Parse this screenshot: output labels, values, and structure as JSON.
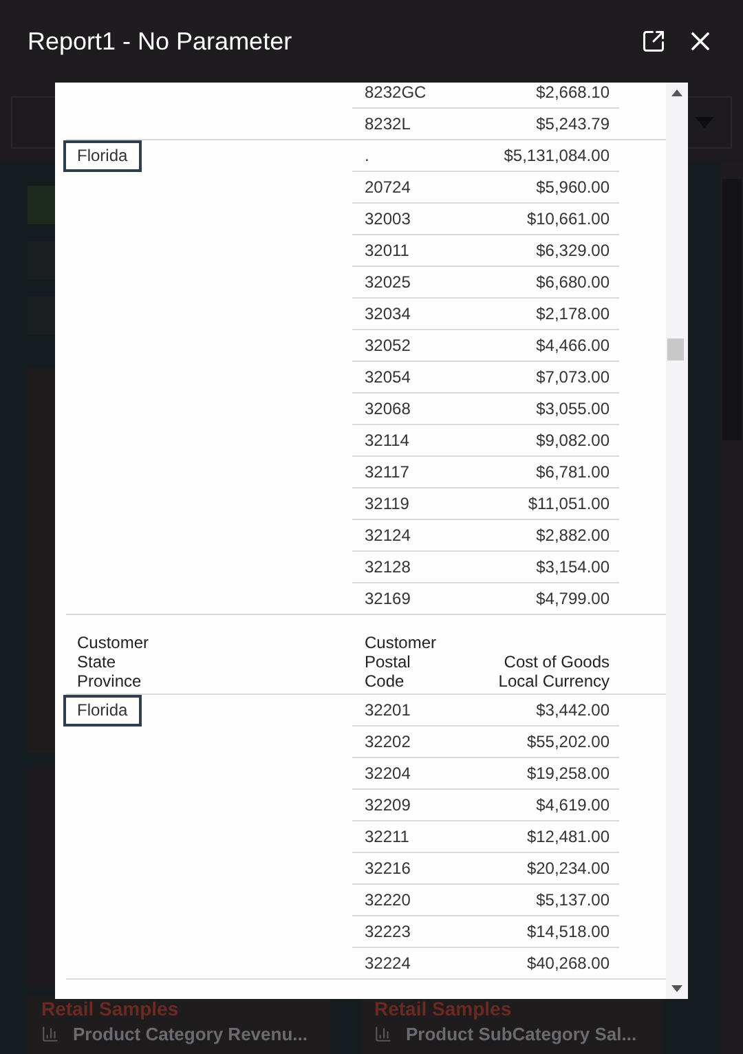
{
  "background": {
    "cards": [
      {
        "source": "Retail Samples",
        "title": "Product Category Revenu..."
      },
      {
        "source": "Retail Samples",
        "title": "Product SubCategory Sal..."
      }
    ]
  },
  "dialog": {
    "title": "Report1 - No Parameter",
    "blocks": [
      {
        "kind": "group",
        "rows": [
          {
            "postal": "8232GC",
            "cost": "$2,668.10"
          },
          {
            "postal": "8232L",
            "cost": "$5,243.79"
          }
        ]
      },
      {
        "kind": "group",
        "state": "Florida",
        "rows": [
          {
            "postal": ".",
            "cost": "$5,131,084.00"
          },
          {
            "postal": "20724",
            "cost": "$5,960.00"
          },
          {
            "postal": "32003",
            "cost": "$10,661.00"
          },
          {
            "postal": "32011",
            "cost": "$6,329.00"
          },
          {
            "postal": "32025",
            "cost": "$6,680.00"
          },
          {
            "postal": "32034",
            "cost": "$2,178.00"
          },
          {
            "postal": "32052",
            "cost": "$4,466.00"
          },
          {
            "postal": "32054",
            "cost": "$7,073.00"
          },
          {
            "postal": "32068",
            "cost": "$3,055.00"
          },
          {
            "postal": "32114",
            "cost": "$9,082.00"
          },
          {
            "postal": "32117",
            "cost": "$6,781.00"
          },
          {
            "postal": "32119",
            "cost": "$11,051.00"
          },
          {
            "postal": "32124",
            "cost": "$2,882.00"
          },
          {
            "postal": "32128",
            "cost": "$3,154.00"
          },
          {
            "postal": "32169",
            "cost": "$4,799.00"
          }
        ]
      },
      {
        "kind": "header",
        "columns": [
          "Customer\nState\nProvince",
          "Customer\nPostal\nCode",
          "Cost of Goods\nLocal Currency"
        ]
      },
      {
        "kind": "group",
        "state": "Florida",
        "rows": [
          {
            "postal": "32201",
            "cost": "$3,442.00"
          },
          {
            "postal": "32202",
            "cost": "$55,202.00"
          },
          {
            "postal": "32204",
            "cost": "$19,258.00"
          },
          {
            "postal": "32209",
            "cost": "$4,619.00"
          },
          {
            "postal": "32211",
            "cost": "$12,481.00"
          },
          {
            "postal": "32216",
            "cost": "$20,234.00"
          },
          {
            "postal": "32220",
            "cost": "$5,137.00"
          },
          {
            "postal": "32223",
            "cost": "$14,518.00"
          },
          {
            "postal": "32224",
            "cost": "$40,268.00"
          }
        ]
      }
    ]
  }
}
